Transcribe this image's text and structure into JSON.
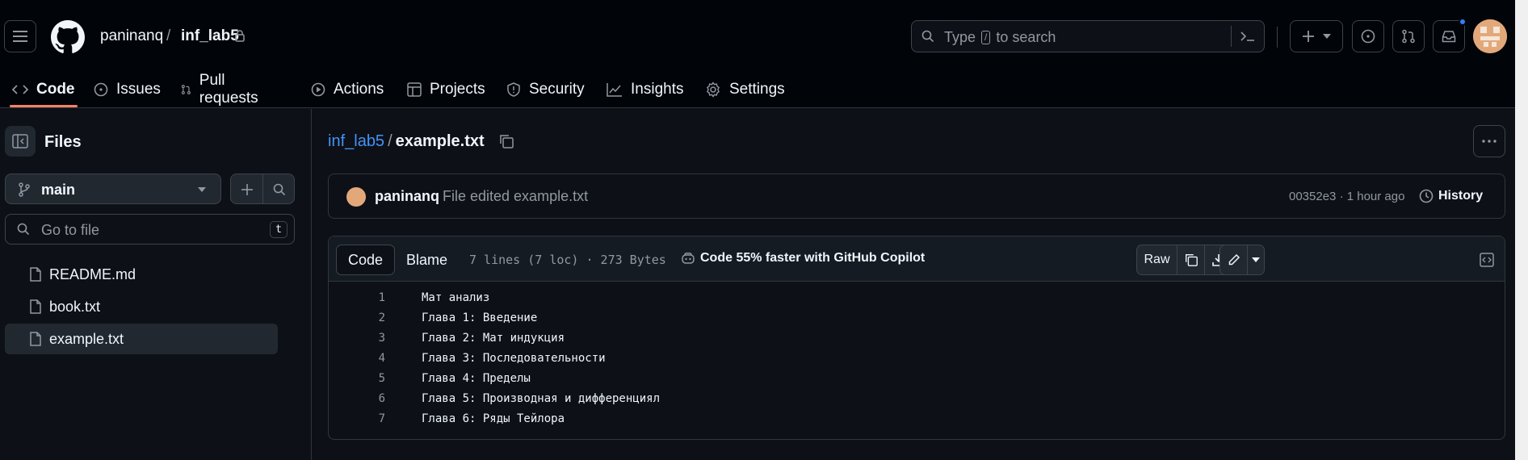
{
  "header": {
    "owner": "paninanq",
    "separator": "/",
    "repo": "inf_lab5",
    "search_placeholder_before": "Type",
    "search_key": "/",
    "search_placeholder_after": "to search"
  },
  "nav": {
    "tabs": [
      {
        "label": "Code",
        "icon": "code-icon",
        "active": true
      },
      {
        "label": "Issues",
        "icon": "issue-icon"
      },
      {
        "label": "Pull requests",
        "icon": "pull-request-icon"
      },
      {
        "label": "Actions",
        "icon": "play-icon"
      },
      {
        "label": "Projects",
        "icon": "table-icon"
      },
      {
        "label": "Security",
        "icon": "shield-icon"
      },
      {
        "label": "Insights",
        "icon": "graph-icon"
      },
      {
        "label": "Settings",
        "icon": "gear-icon"
      }
    ]
  },
  "sidebar": {
    "title": "Files",
    "branch": "main",
    "goto_placeholder": "Go to file",
    "goto_key": "t",
    "files": [
      {
        "name": "README.md",
        "active": false
      },
      {
        "name": "book.txt",
        "active": false
      },
      {
        "name": "example.txt",
        "active": true
      }
    ]
  },
  "main": {
    "breadcrumb_repo": "inf_lab5",
    "breadcrumb_sep": "/",
    "breadcrumb_file": "example.txt",
    "commit": {
      "author": "paninanq",
      "message": "File edited example.txt",
      "meta": "00352e3 · 1 hour ago",
      "history_label": "History"
    },
    "code_header": {
      "tab_code": "Code",
      "tab_blame": "Blame",
      "stats": "7 lines (7 loc) · 273 Bytes",
      "copilot": "Code 55% faster with GitHub Copilot",
      "raw": "Raw"
    },
    "lines": [
      {
        "n": "1",
        "text": "Мат анализ"
      },
      {
        "n": "2",
        "text": "Глава 1: Введение"
      },
      {
        "n": "3",
        "text": "Глава 2: Мат индукция"
      },
      {
        "n": "4",
        "text": "Глава 3: Последовательности"
      },
      {
        "n": "5",
        "text": "Глава 4: Пределы"
      },
      {
        "n": "6",
        "text": "Глава 5: Производная и дифференциял"
      },
      {
        "n": "7",
        "text": "Глава 6: Ряды Тейлора"
      }
    ]
  },
  "colors": {
    "accent_link": "#4493f8",
    "tab_underline": "#f78166",
    "notification": "#2f81f7"
  }
}
